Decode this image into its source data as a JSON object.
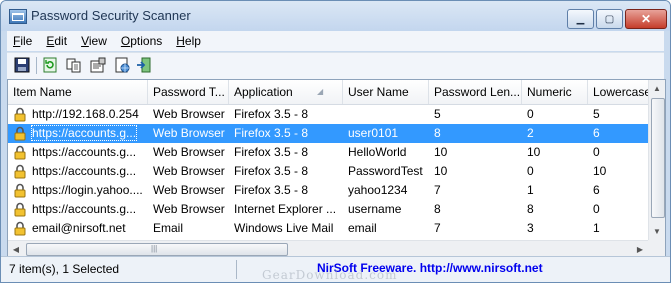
{
  "window": {
    "title": "Password Security Scanner"
  },
  "menu": [
    "File",
    "Edit",
    "View",
    "Options",
    "Help"
  ],
  "toolbar": [
    {
      "icon": "save-icon"
    },
    {
      "icon": "refresh-icon"
    },
    {
      "icon": "copy-icon"
    },
    {
      "icon": "properties-icon"
    },
    {
      "icon": "html-report-icon"
    },
    {
      "icon": "exit-icon"
    }
  ],
  "table": {
    "columns": [
      "Item Name",
      "Password T...",
      "Application",
      "User Name",
      "Password Len...",
      "Numeric",
      "Lowercase"
    ],
    "sorted_column": "Application",
    "rows": [
      {
        "item": "http://192.168.0.254",
        "type": "Web Browser",
        "app": "Firefox 3.5 - 8",
        "user": "",
        "len": "5",
        "numeric": "0",
        "lower": "5",
        "selected": false
      },
      {
        "item": "https://accounts.g...",
        "type": "Web Browser",
        "app": "Firefox 3.5 - 8",
        "user": "user0101",
        "len": "8",
        "numeric": "2",
        "lower": "6",
        "selected": true
      },
      {
        "item": "https://accounts.g...",
        "type": "Web Browser",
        "app": "Firefox 3.5 - 8",
        "user": "HelloWorld",
        "len": "10",
        "numeric": "10",
        "lower": "0",
        "selected": false
      },
      {
        "item": "https://accounts.g...",
        "type": "Web Browser",
        "app": "Firefox 3.5 - 8",
        "user": "PasswordTest",
        "len": "10",
        "numeric": "0",
        "lower": "10",
        "selected": false
      },
      {
        "item": "https://login.yahoo....",
        "type": "Web Browser",
        "app": "Firefox 3.5 - 8",
        "user": "yahoo1234",
        "len": "7",
        "numeric": "1",
        "lower": "6",
        "selected": false
      },
      {
        "item": "https://accounts.g...",
        "type": "Web Browser",
        "app": "Internet Explorer ...",
        "user": "username",
        "len": "8",
        "numeric": "8",
        "lower": "0",
        "selected": false
      },
      {
        "item": "email@nirsoft.net",
        "type": "Email",
        "app": "Windows Live Mail",
        "user": "email",
        "len": "7",
        "numeric": "3",
        "lower": "1",
        "selected": false
      }
    ]
  },
  "status": {
    "selection": "7 item(s), 1 Selected",
    "link": "NirSoft Freeware.  http://www.nirsoft.net"
  },
  "watermark": "GearDownload.com",
  "colors": {
    "selection": "#3399ff",
    "link": "#0000ee"
  }
}
